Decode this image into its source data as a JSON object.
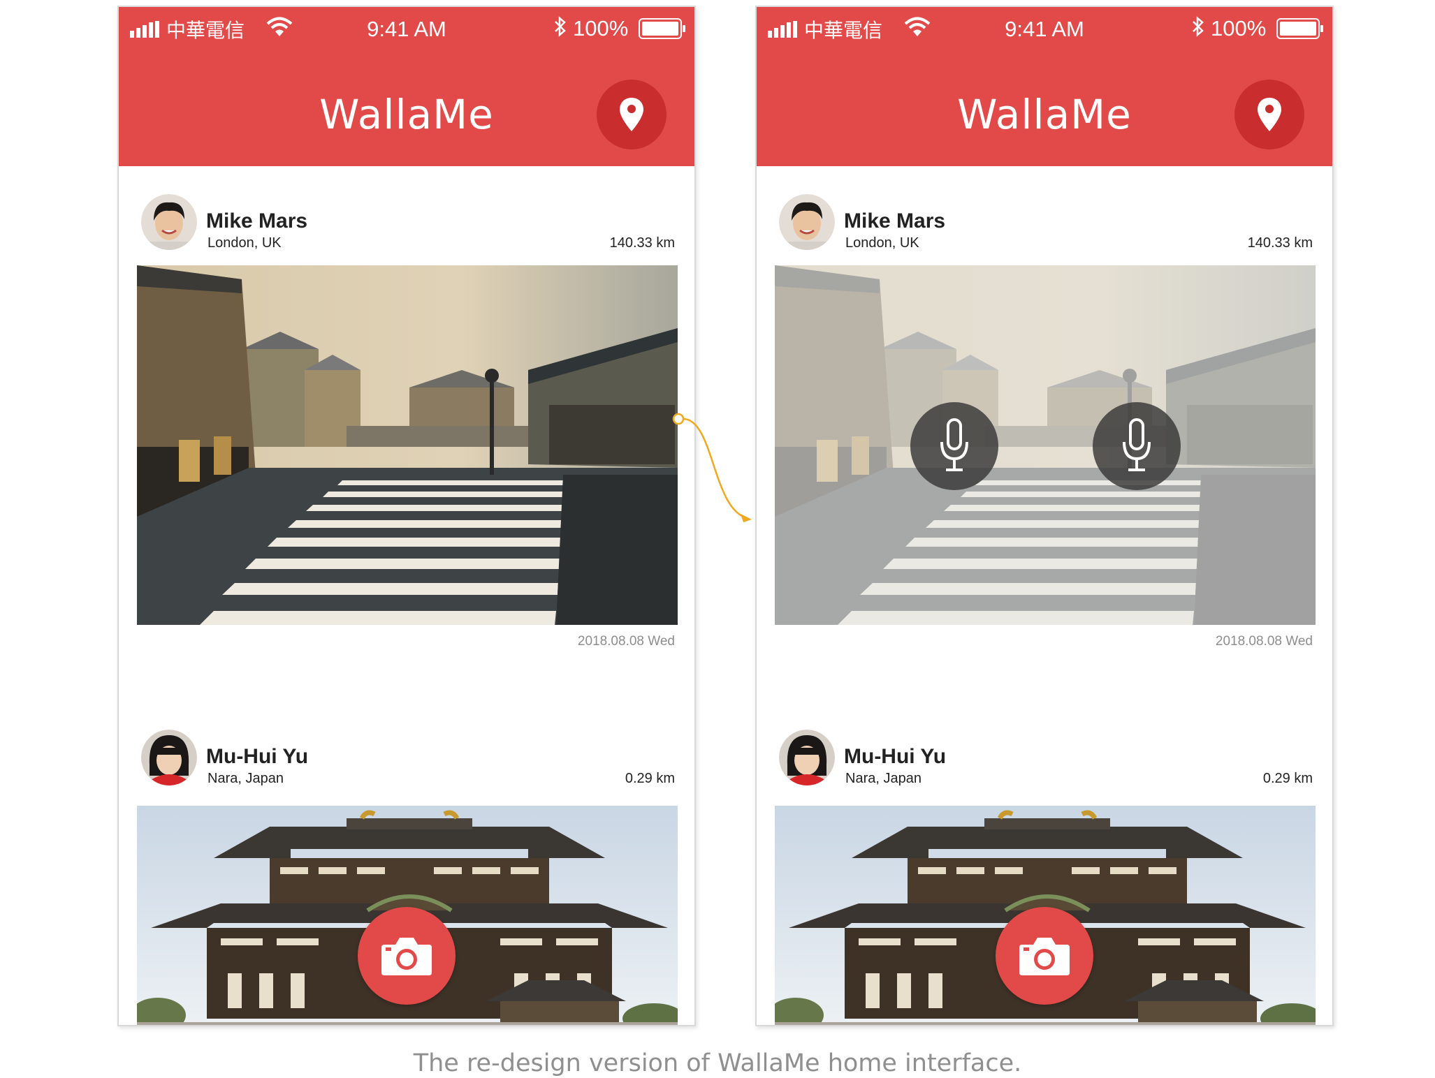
{
  "status_bar": {
    "carrier": "中華電信",
    "time": "9:41 AM",
    "battery": "100%"
  },
  "app": {
    "title": "WallaMe",
    "accent_color": "#e24a49"
  },
  "posts": [
    {
      "name": "Mike Mars",
      "place": "London, UK",
      "distance": "140.33 km",
      "date": "2018.08.08 Wed",
      "photo": "paris-crosswalk-street"
    },
    {
      "name": "Mu-Hui Yu",
      "place": "Nara, Japan",
      "distance": "0.29 km",
      "photo": "nara-temple"
    }
  ],
  "icons": [
    "signal-icon",
    "wifi-icon",
    "bluetooth-icon",
    "battery-icon",
    "location-pin-icon",
    "microphone-icon",
    "camera-icon"
  ],
  "caption": "The re-design version of WallaMe home interface."
}
